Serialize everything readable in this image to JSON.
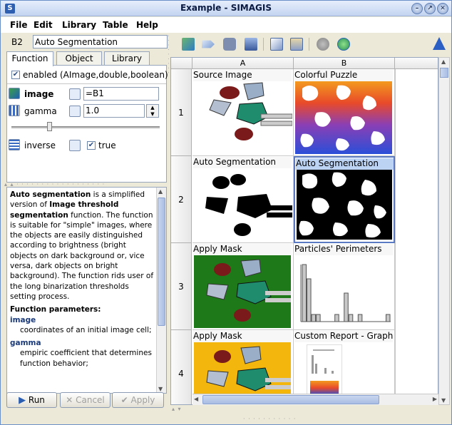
{
  "window": {
    "title": "Example - SIMAGIS",
    "app_icon": "simagis-icon",
    "controls": [
      "minimize",
      "restore",
      "close"
    ]
  },
  "menu": [
    "File",
    "Edit",
    "Library",
    "Table",
    "Help"
  ],
  "name_box": {
    "cell_ref": "B2",
    "value": "Auto Segmentation"
  },
  "tabs": [
    {
      "label": "Function",
      "active": true
    },
    {
      "label": "Object",
      "active": false
    },
    {
      "label": "Library",
      "active": false
    }
  ],
  "function_panel": {
    "enabled_label": "enabled",
    "enabled_checked": true,
    "signature": "(AImage,double,boolean)",
    "params": [
      {
        "name": "image",
        "value": "=B1"
      },
      {
        "name": "gamma",
        "value": "1.0"
      },
      {
        "name": "inverse",
        "value": "true",
        "checked": true
      }
    ],
    "gamma_slider_fraction": 0.25
  },
  "description": {
    "intro_bold1": "Auto segmentation",
    "intro1": " is a simplified version of ",
    "intro_bold2": "Image threshold segmentation",
    "intro2": " function. The function is suitable for \"simple\" images, where the objects are easily distinguished according to brightness (bright objects on dark background or, vice versa, dark objects on bright background). The function rids user of the long binarization thresholds setting process.",
    "params_heading": "Function parameters:",
    "p1_name": "image",
    "p1_desc": "coordinates of an initial image cell;",
    "p2_name": "gamma",
    "p2_desc": "empiric coefficient that determines function behavior;"
  },
  "buttons": {
    "run": "Run",
    "cancel": "Cancel",
    "apply": "Apply"
  },
  "grid": {
    "columns": [
      "A",
      "B"
    ],
    "rows": [
      "1",
      "2",
      "3",
      "4"
    ],
    "cells": [
      {
        "label": "Source Image"
      },
      {
        "label": "Colorful Puzzle"
      },
      {
        "label": "Auto Segmentation"
      },
      {
        "label": "Auto Segmentation"
      },
      {
        "label": "Apply Mask"
      },
      {
        "label": "Particles' Perimeters"
      },
      {
        "label": "Apply Mask"
      },
      {
        "label": "Custom Report - Graph..."
      }
    ],
    "histogram_values": [
      8,
      6,
      1,
      1,
      0,
      0,
      0,
      1,
      0,
      4,
      1,
      0,
      1,
      0,
      0,
      0,
      0,
      0,
      1
    ]
  },
  "colors": {
    "selection": "#bcd3f3",
    "mask_green": "#1e7a18",
    "mask_yellow": "#f2b60c",
    "accent": "#2e5fb0"
  }
}
